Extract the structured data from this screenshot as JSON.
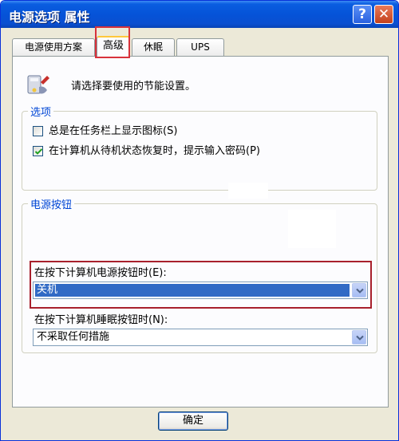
{
  "window": {
    "title": "电源选项 属性"
  },
  "titlebar_buttons": {
    "help_glyph": "?",
    "close_glyph": "✕"
  },
  "tabs": [
    {
      "label": "电源使用方案",
      "active": false
    },
    {
      "label": "高级",
      "active": true
    },
    {
      "label": "休眠",
      "active": false
    },
    {
      "label": "UPS",
      "active": false
    }
  ],
  "intro": {
    "text": "请选择要使用的节能设置。",
    "icon": "power-options-icon"
  },
  "options_group": {
    "legend": "选项",
    "items": [
      {
        "label": "总是在任务栏上显示图标(S)",
        "checked": false
      },
      {
        "label": "在计算机从待机状态恢复时，提示输入密码(P)",
        "checked": true
      }
    ]
  },
  "power_buttons_group": {
    "legend": "电源按钮",
    "power_button": {
      "label": "在按下计算机电源按钮时(E):",
      "value": "关机"
    },
    "sleep_button": {
      "label": "在按下计算机睡眠按钮时(N):",
      "value": "不采取任何措施"
    }
  },
  "footer": {
    "ok_label": "确定"
  },
  "colors": {
    "title_bar": "#0553d8",
    "legend_text": "#0046d5",
    "selection": "#316ac5",
    "highlight_box": "#d8323c"
  }
}
